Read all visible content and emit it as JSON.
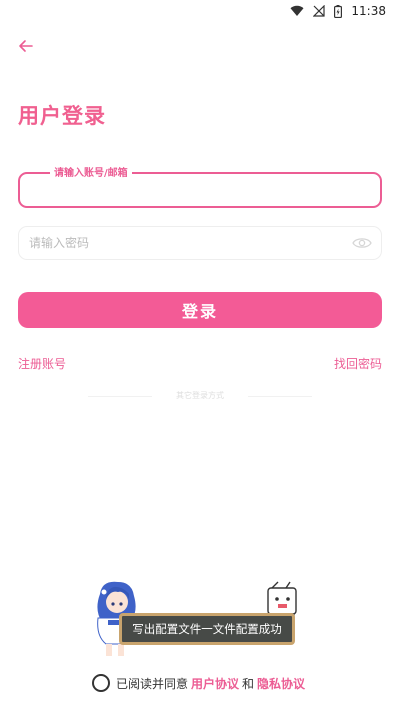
{
  "status_bar": {
    "time": "11:38"
  },
  "title": "用户登录",
  "username": {
    "label": "请输入账号/邮箱",
    "value": ""
  },
  "password": {
    "placeholder": "请输入密码",
    "value": ""
  },
  "login_button": "登录",
  "links": {
    "register": "注册账号",
    "forgot": "找回密码"
  },
  "divider_text": "其它登录方式",
  "toast": "写出配置文件一文件配置成功",
  "agreement": {
    "prefix": "已阅读并同意",
    "user_agreement": "用户协议",
    "and": "和",
    "privacy_agreement": "隐私协议"
  },
  "colors": {
    "accent": "#f35b96",
    "toast_bg": "#474a47",
    "toast_border": "#c9a46d"
  }
}
